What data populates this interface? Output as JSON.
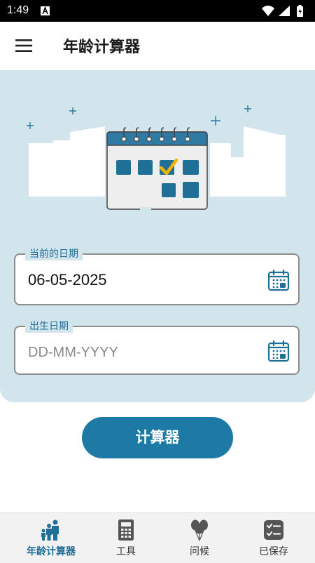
{
  "status_bar": {
    "time": "1:49"
  },
  "app_bar": {
    "title": "年龄计算器",
    "menu_icon": "hamburger-menu-icon"
  },
  "current_date_field": {
    "label": "当前的日期",
    "value": "06-05-2025",
    "icon": "calendar-icon"
  },
  "birth_date_field": {
    "label": "出生日期",
    "placeholder": "DD-MM-YYYY",
    "icon": "calendar-icon"
  },
  "calculate_button": {
    "label": "计算器"
  },
  "bottom_nav": {
    "items": [
      {
        "label": "年龄计算器",
        "icon": "family-icon",
        "active": true
      },
      {
        "label": "工具",
        "icon": "calculator-icon",
        "active": false
      },
      {
        "label": "问候",
        "icon": "balloons-icon",
        "active": false
      },
      {
        "label": "已保存",
        "icon": "checklist-icon",
        "active": false
      }
    ]
  },
  "colors": {
    "accent": "#1d7aa5",
    "hero_bg": "#d2e4ec",
    "label_blue": "#1e6f96",
    "calendar_header": "#2f7ba3",
    "check_yellow": "#f4b400"
  }
}
